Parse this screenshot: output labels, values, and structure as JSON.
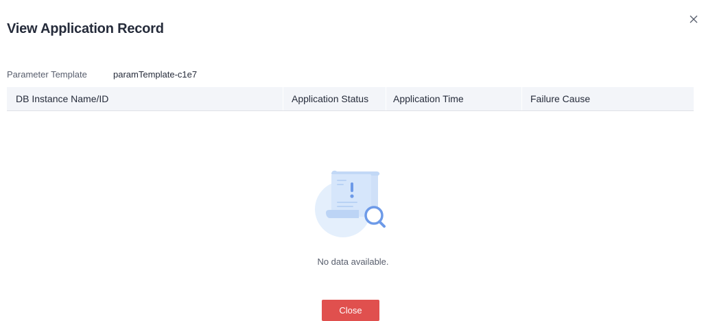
{
  "dialog": {
    "title": "View Application Record",
    "close_icon": "close-icon"
  },
  "template": {
    "label": "Parameter Template",
    "value": "paramTemplate-c1e7"
  },
  "table": {
    "columns": [
      "DB Instance Name/ID",
      "Application Status",
      "Application Time",
      "Failure Cause"
    ],
    "rows": [],
    "empty_text": "No data available.",
    "empty_icon": "no-data-search-icon"
  },
  "footer": {
    "close_label": "Close"
  },
  "colors": {
    "primary_button": "#e0504e",
    "header_background": "#f3f5f9"
  }
}
